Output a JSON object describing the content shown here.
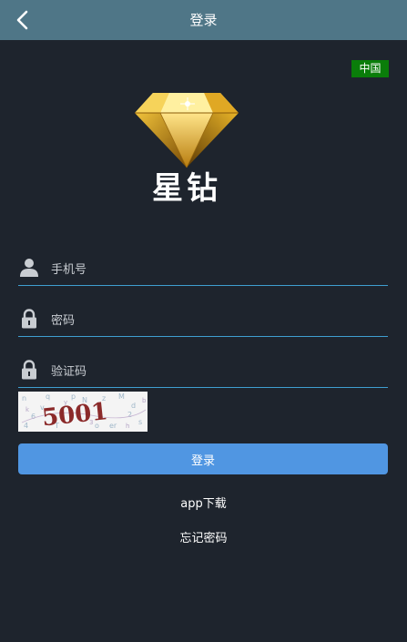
{
  "header": {
    "title": "登录"
  },
  "region": {
    "label": "中国"
  },
  "logo": {
    "text": "星钻"
  },
  "form": {
    "phone_placeholder": "手机号",
    "password_placeholder": "密码",
    "captcha_placeholder": "验证码",
    "captcha_text": "5001",
    "submit_label": "登录"
  },
  "links": {
    "app_download": "app下载",
    "forgot_password": "忘记密码"
  },
  "colors": {
    "header_bg": "#4f7687",
    "page_bg": "#1e242d",
    "accent_line": "#3f9fd0",
    "button_bg": "#5096e2",
    "region_badge_bg": "#0a7d0a",
    "captcha_text": "#8b2a2a"
  }
}
